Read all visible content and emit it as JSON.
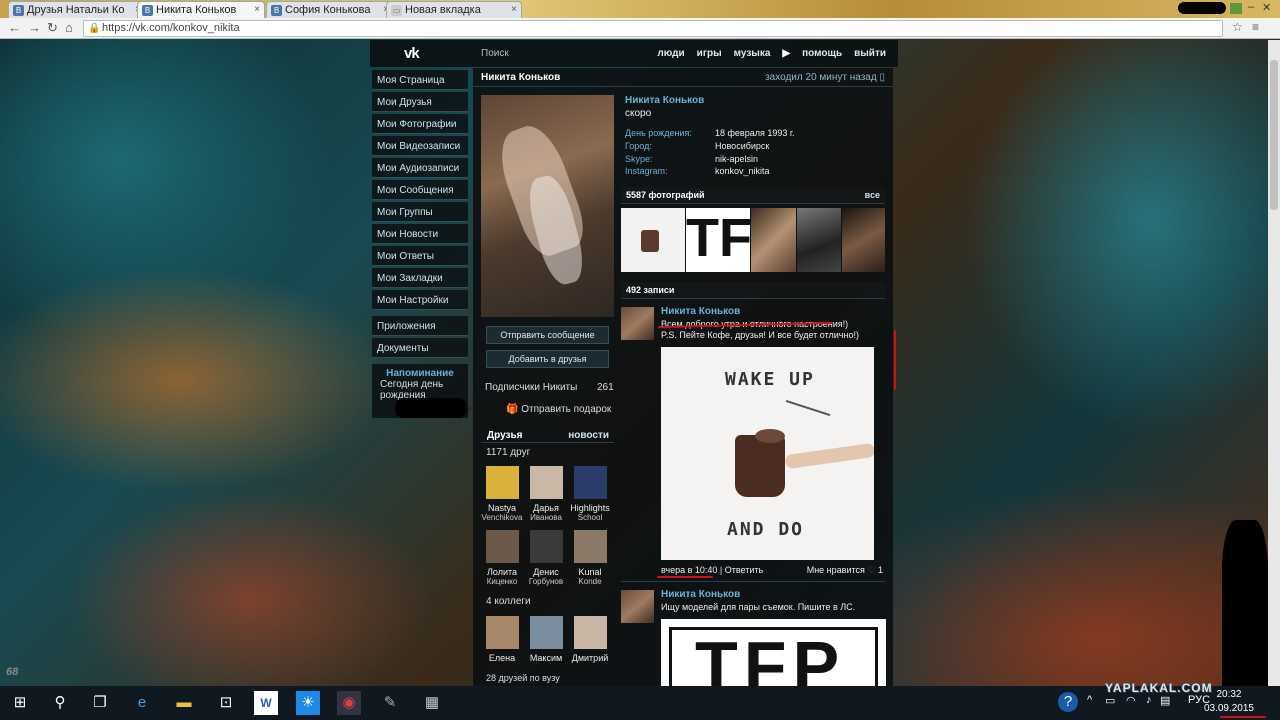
{
  "browser": {
    "tabs": [
      {
        "label": "Друзья Натальи Ко",
        "icon": "vk-favicon"
      },
      {
        "label": "Никита Коньков",
        "icon": "vk-favicon",
        "active": true
      },
      {
        "label": "София Конькова",
        "icon": "vk-favicon"
      },
      {
        "label": "Новая вкладка",
        "icon": "blank-page-icon"
      }
    ],
    "url": "https://vk.com/konkov_nikita"
  },
  "vk": {
    "logo": "vk",
    "search": "Поиск",
    "nav": [
      "люди",
      "игры",
      "музыка",
      "помощь",
      "выйти"
    ],
    "sidebar": [
      "Моя Страница",
      "Мои Друзья",
      "Мои Фотографии",
      "Мои Видеозаписи",
      "Мои Аудиозаписи",
      "Мои Сообщения",
      "Мои Группы",
      "Мои Новости",
      "Мои Ответы",
      "Мои Закладки",
      "Мои Настройки",
      "Приложения",
      "Документы"
    ],
    "reminder": {
      "title": "Напоминание",
      "text1": "Сегодня день",
      "text2": "рождения"
    },
    "profile": {
      "header_name": "Никита Коньков",
      "last_seen": "заходил 20 минут назад",
      "name": "Никита Коньков",
      "status": "скоро",
      "info": [
        {
          "k": "День рождения:",
          "v": "18 февраля 1993 г."
        },
        {
          "k": "Город:",
          "v": "Новосибирск"
        },
        {
          "k": "Skype:",
          "v": "nik-apelsin"
        },
        {
          "k": "Instagram:",
          "v": "konkov_nikita"
        }
      ],
      "send_message": "Отправить сообщение",
      "add_friend": "Добавить в друзья",
      "subscribers_label": "Подписчики Никиты",
      "subscribers_count": "261",
      "gift": "Отправить подарок",
      "friends_title": "Друзья",
      "friends_news": "новости",
      "friends_count": "1171 друг",
      "friends": [
        {
          "n1": "Nastya",
          "n2": "Venchikova",
          "color": "#d8b03a"
        },
        {
          "n1": "Дарья",
          "n2": "Иванова",
          "color": "#c9b8a6"
        },
        {
          "n1": "Highlights",
          "n2": "School",
          "color": "#2a3c6a"
        },
        {
          "n1": "Лолита",
          "n2": "Киценко",
          "color": "#6b5a4a"
        },
        {
          "n1": "Денис",
          "n2": "Горбунов",
          "color": "#3a3a3a"
        },
        {
          "n1": "Kunal",
          "n2": "Konde",
          "color": "#8c7a68"
        }
      ],
      "colleagues_count": "4 коллеги",
      "colleagues": [
        {
          "n1": "Елена",
          "color": "#a8886a"
        },
        {
          "n1": "Максим",
          "color": "#7a8ea0"
        },
        {
          "n1": "Дмитрий",
          "color": "#c9b6a4"
        }
      ],
      "vuz": "28 друзей по вузу",
      "photos_label": "5587 фотографий",
      "photos_all": "все",
      "posts_count": "492 записи",
      "posts": [
        {
          "author": "Никита Коньков",
          "text1": "Всем доброго утра и отличного настроения!)",
          "text2": "P.S. Пейте Кофе, друзья! И все будет отлично!)",
          "image_top": "WAKE UP",
          "image_bottom": "AND DO",
          "date": "вчера в 10:40",
          "reply": "Ответить",
          "like_label": "Мне нравится",
          "like_count": "1"
        },
        {
          "author": "Никита Коньков",
          "text1": "Ищу моделей для пары съемок. Пишите в ЛС.",
          "image_text": "TFP"
        }
      ]
    }
  },
  "watermark": "YAPLAKAL.COM",
  "taskbar": {
    "lang": "РУС",
    "time": "20:32",
    "date": "03.09.2015",
    "icons": [
      "windows-start-icon",
      "search-icon",
      "task-view-icon",
      "edge-icon",
      "file-explorer-icon",
      "store-icon",
      "word-icon",
      "weather-icon",
      "chrome-icon",
      "paint-icon",
      "calculator-icon"
    ]
  },
  "corner_mark": "68",
  "photo_thumb_text": "TFP"
}
